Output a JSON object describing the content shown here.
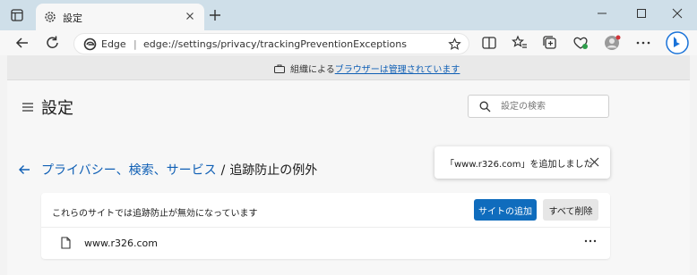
{
  "browser": {
    "tab_title": "設定",
    "omnibox_label": "Edge",
    "omnibox_separator": "|",
    "url": "edge://settings/privacy/trackingPreventionExceptions"
  },
  "managed_bar": {
    "prefix": "組織による",
    "link": "ブラウザーは管理されています"
  },
  "settings": {
    "title": "設定",
    "search_placeholder": "設定の検索"
  },
  "breadcrumb": {
    "parent": "プライバシー、検索、サービス",
    "separator": "/",
    "current": "追跡防止の例外"
  },
  "toast": {
    "message": "「www.r326.com」を追加しました"
  },
  "exceptions_card": {
    "description": "これらのサイトでは追跡防止が無効になっています",
    "add_button": "サイトの追加",
    "remove_all_button": "すべて削除",
    "sites": [
      "www.r326.com"
    ]
  },
  "colors": {
    "accent": "#0f6cbd",
    "link": "#0f5fb5",
    "tabstrip": "#cfdfe9"
  },
  "icons": [
    "window-icon",
    "gear-icon",
    "close-icon",
    "new-tab-icon",
    "minimize-icon",
    "maximize-icon",
    "window-close-icon",
    "back-icon",
    "refresh-icon",
    "edge-icon",
    "favorite-star-icon",
    "split-screen-icon",
    "favorites-icon",
    "collections-icon",
    "browser-essentials-icon",
    "profile-avatar",
    "more-icon",
    "bing-icon",
    "briefcase-icon",
    "hamburger-icon",
    "search-icon",
    "back-arrow-icon",
    "file-icon",
    "more-actions-icon"
  ]
}
